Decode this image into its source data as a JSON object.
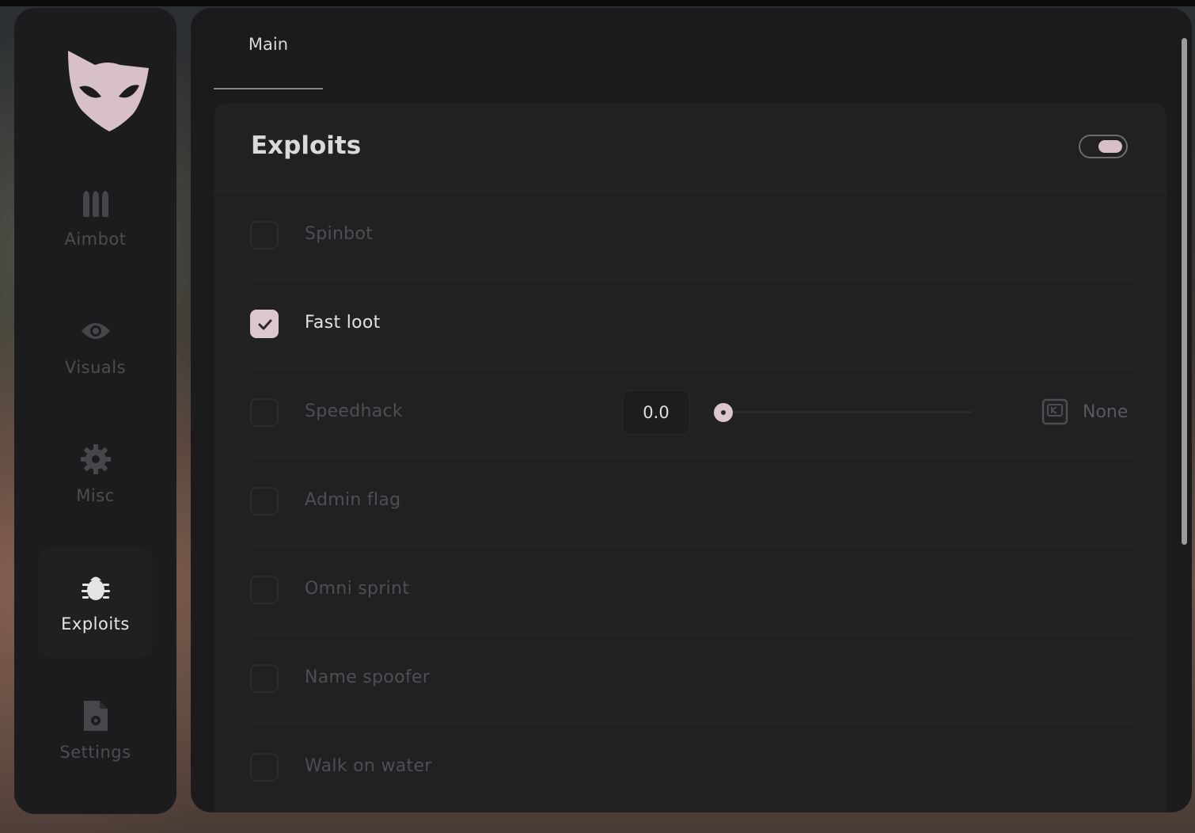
{
  "sidebar": {
    "items": [
      {
        "label": "Aimbot",
        "icon": "bullets-icon",
        "active": false
      },
      {
        "label": "Visuals",
        "icon": "eye-icon",
        "active": false
      },
      {
        "label": "Misc",
        "icon": "gear-icon",
        "active": false
      },
      {
        "label": "Exploits",
        "icon": "bug-icon",
        "active": true
      },
      {
        "label": "Settings",
        "icon": "file-gear-icon",
        "active": false
      }
    ]
  },
  "tabs": [
    {
      "label": "Main",
      "active": true
    }
  ],
  "section": {
    "title": "Exploits",
    "enabled": true,
    "options": [
      {
        "label": "Spinbot",
        "checked": false
      },
      {
        "label": "Fast loot",
        "checked": true
      },
      {
        "label": "Speedhack",
        "checked": false
      },
      {
        "label": "Admin flag",
        "checked": false
      },
      {
        "label": "Omni sprint",
        "checked": false
      },
      {
        "label": "Name spoofer",
        "checked": false
      },
      {
        "label": "Walk on water",
        "checked": false
      }
    ],
    "speedhack": {
      "value": "0.0",
      "slider_fraction": 0.0,
      "keybind": "None"
    }
  },
  "colors": {
    "accent": "#dcc6cf",
    "panel": "#1b1b1e",
    "card": "#212124",
    "sidebar": "#1c1c1f"
  }
}
